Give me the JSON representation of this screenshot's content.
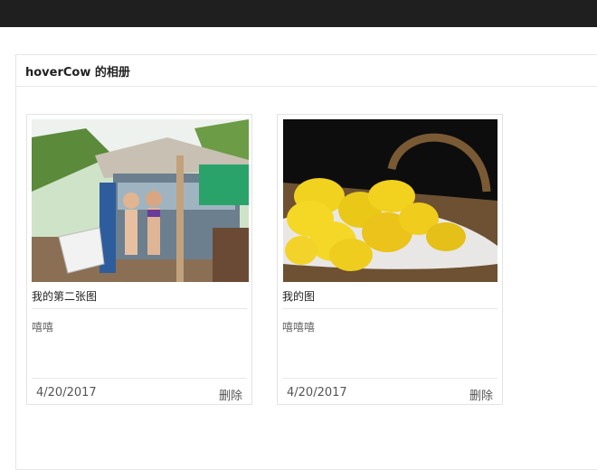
{
  "album": {
    "title": "hoverCow 的相册"
  },
  "photos": [
    {
      "image": "beach-shack-photo",
      "title": "我的第二张图",
      "description": "嘻嘻",
      "date": "4/20/2017",
      "delete_label": "删除"
    },
    {
      "image": "lemon-basket-photo",
      "title": "我的图",
      "description": "嘻嘻嘻",
      "date": "4/20/2017",
      "delete_label": "删除"
    }
  ]
}
